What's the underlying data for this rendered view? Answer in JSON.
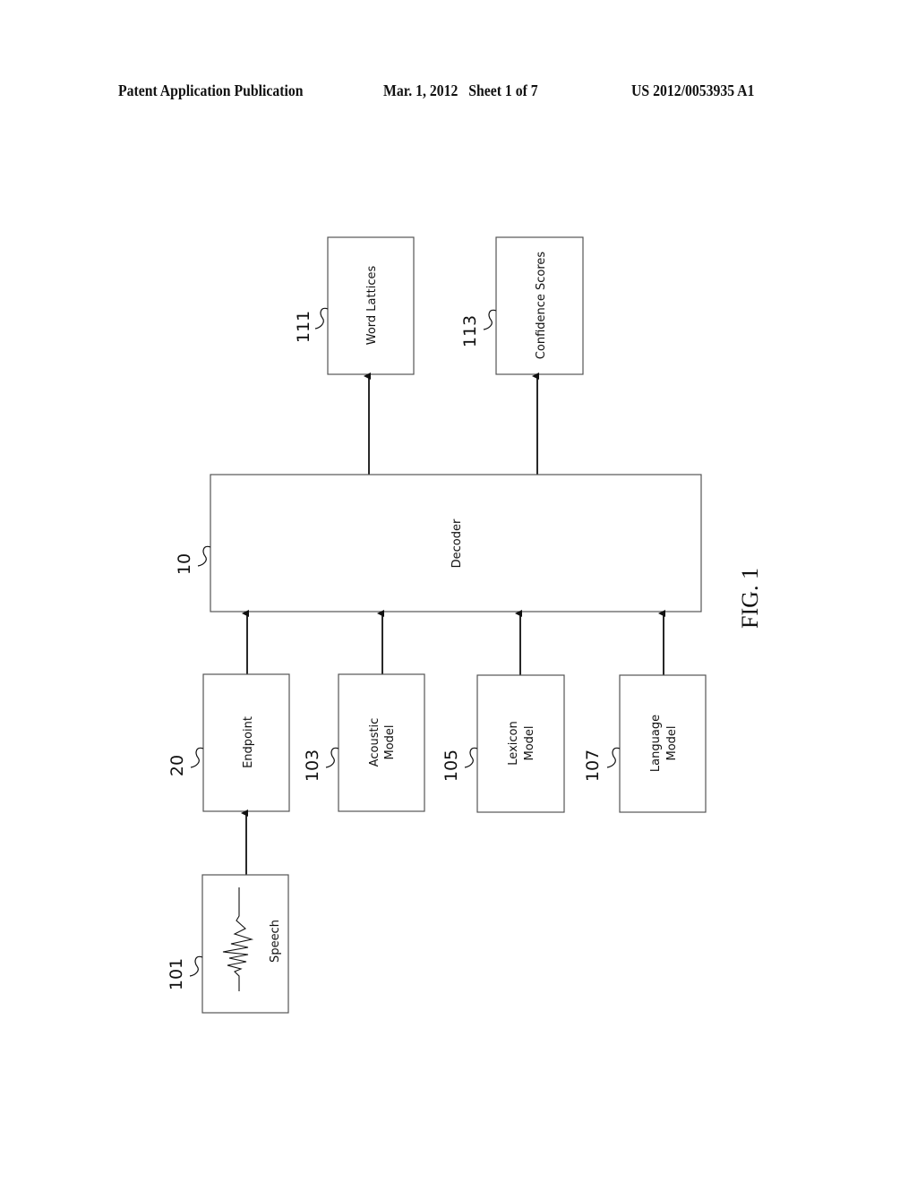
{
  "header": {
    "publication": "Patent Application Publication",
    "date_sheet": "Mar. 1, 2012   Sheet 1 of 7",
    "number": "US 2012/0053935 A1"
  },
  "figure": {
    "caption": "FIG. 1",
    "blocks": {
      "speech": {
        "ref": "101",
        "label": "Speech",
        "icon": "waveform-icon"
      },
      "endpoint": {
        "ref": "20",
        "label": "Endpoint"
      },
      "acoustic": {
        "ref": "103",
        "line1": "Acoustic",
        "line2": "Model"
      },
      "lexicon": {
        "ref": "105",
        "line1": "Lexicon",
        "line2": "Model"
      },
      "language": {
        "ref": "107",
        "line1": "Language",
        "line2": "Model"
      },
      "decoder": {
        "ref": "10",
        "label": "Decoder"
      },
      "word_lattices": {
        "ref": "111",
        "label": "Word Lattices"
      },
      "confidence": {
        "ref": "113",
        "label": "Confidence Scores"
      }
    }
  }
}
